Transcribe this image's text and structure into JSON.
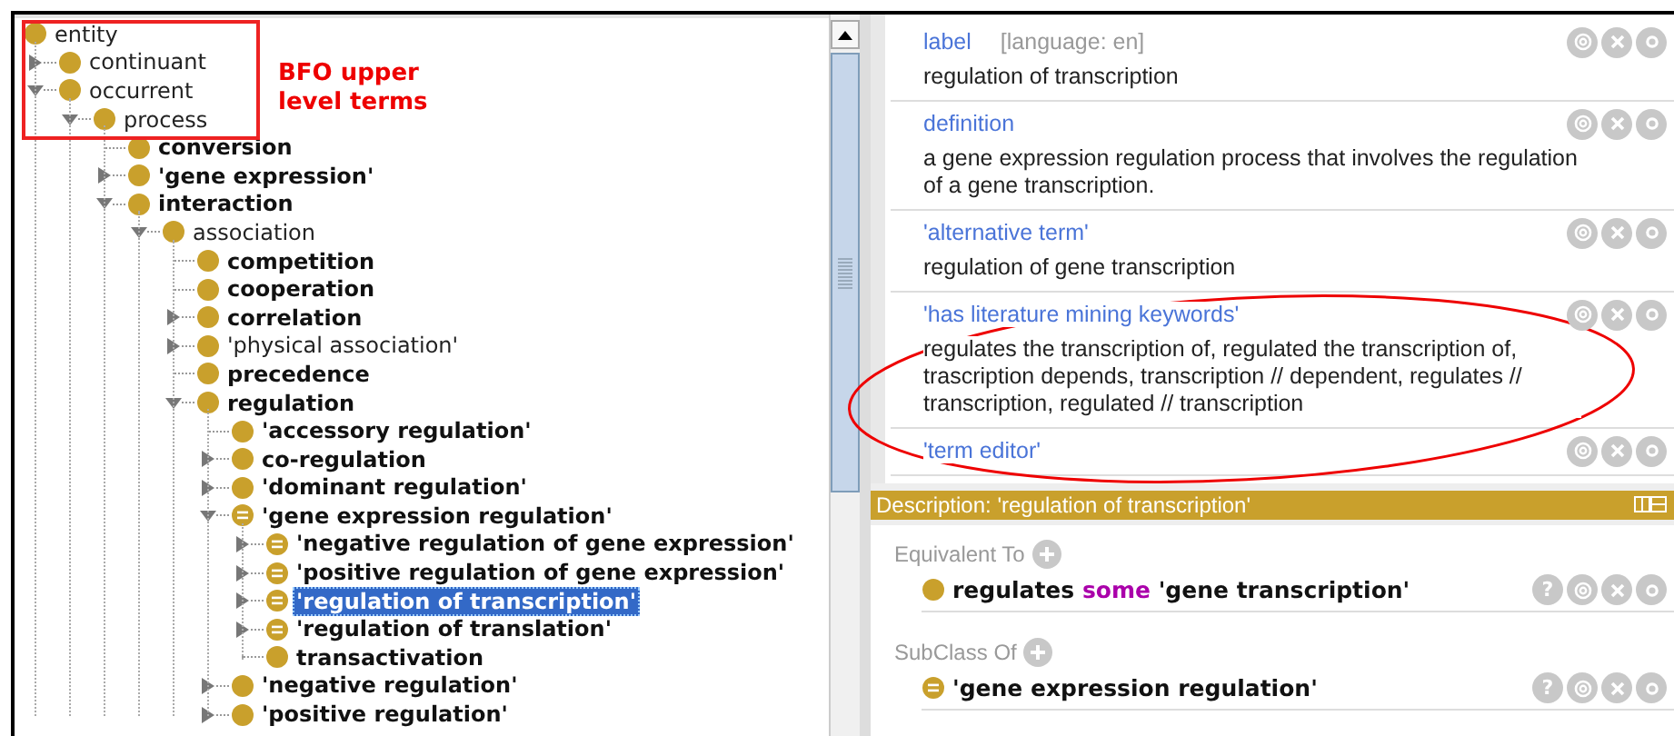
{
  "annotation_note": {
    "text": "BFO upper level terms"
  },
  "tree": [
    {
      "label": "entity",
      "bold": false,
      "defined": false,
      "selected": false,
      "children": [
        {
          "label": "continuant",
          "bold": false,
          "defined": false,
          "selected": false,
          "expanded": false
        },
        {
          "label": "occurrent",
          "bold": false,
          "defined": false,
          "selected": false,
          "expanded": true,
          "children": [
            {
              "label": "process",
              "bold": false,
              "defined": false,
              "selected": false,
              "expanded": true,
              "children": [
                {
                  "label": "conversion",
                  "bold": true,
                  "defined": false,
                  "selected": false
                },
                {
                  "label": "'gene expression'",
                  "bold": true,
                  "defined": false,
                  "selected": false,
                  "expanded": false
                },
                {
                  "label": "interaction",
                  "bold": true,
                  "defined": false,
                  "selected": false,
                  "expanded": true,
                  "children": [
                    {
                      "label": "association",
                      "bold": false,
                      "defined": false,
                      "selected": false,
                      "expanded": true,
                      "children": [
                        {
                          "label": "competition",
                          "bold": true,
                          "defined": false,
                          "selected": false
                        },
                        {
                          "label": "cooperation",
                          "bold": true,
                          "defined": false,
                          "selected": false
                        },
                        {
                          "label": "correlation",
                          "bold": true,
                          "defined": false,
                          "selected": false,
                          "expanded": false
                        },
                        {
                          "label": "'physical association'",
                          "bold": false,
                          "defined": false,
                          "selected": false,
                          "expanded": false
                        },
                        {
                          "label": "precedence",
                          "bold": true,
                          "defined": false,
                          "selected": false
                        },
                        {
                          "label": "regulation",
                          "bold": true,
                          "defined": false,
                          "selected": false,
                          "expanded": true,
                          "children": [
                            {
                              "label": "'accessory regulation'",
                              "bold": true,
                              "defined": false,
                              "selected": false
                            },
                            {
                              "label": "co-regulation",
                              "bold": true,
                              "defined": false,
                              "selected": false,
                              "expanded": false
                            },
                            {
                              "label": "'dominant regulation'",
                              "bold": true,
                              "defined": false,
                              "selected": false,
                              "expanded": false
                            },
                            {
                              "label": "'gene expression regulation'",
                              "bold": true,
                              "defined": true,
                              "selected": false,
                              "expanded": true,
                              "children": [
                                {
                                  "label": "'negative regulation of gene expression'",
                                  "bold": true,
                                  "defined": true,
                                  "selected": false,
                                  "expanded": false
                                },
                                {
                                  "label": "'positive regulation of gene expression'",
                                  "bold": true,
                                  "defined": true,
                                  "selected": false,
                                  "expanded": false
                                },
                                {
                                  "label": "'regulation of transcription'",
                                  "bold": true,
                                  "defined": true,
                                  "selected": true,
                                  "expanded": false
                                },
                                {
                                  "label": "'regulation of translation'",
                                  "bold": true,
                                  "defined": true,
                                  "selected": false,
                                  "expanded": false
                                },
                                {
                                  "label": "transactivation",
                                  "bold": true,
                                  "defined": false,
                                  "selected": false
                                }
                              ]
                            },
                            {
                              "label": "'negative regulation'",
                              "bold": true,
                              "defined": false,
                              "selected": false,
                              "expanded": false
                            },
                            {
                              "label": "'positive regulation'",
                              "bold": true,
                              "defined": false,
                              "selected": false,
                              "expanded": false
                            }
                          ]
                        }
                      ]
                    }
                  ]
                }
              ]
            }
          ]
        }
      ]
    }
  ],
  "annotations": [
    {
      "property": "label",
      "language": "[language: en]",
      "value": "regulation of transcription"
    },
    {
      "property": "definition",
      "value": "a gene expression regulation process that involves the regulation of a gene transcription."
    },
    {
      "property": "'alternative term'",
      "value": "regulation of gene transcription"
    },
    {
      "property": "'has literature mining keywords'",
      "value": "regulates the transcription of, regulated the transcription of, trascription depends, transcription // dependent, regulates // transcription, regulated // transcription"
    },
    {
      "property": "'term editor'"
    }
  ],
  "description": {
    "title": "Description: 'regulation of transcription'",
    "sections": [
      {
        "heading": "Equivalent To",
        "items": [
          {
            "defined": false,
            "explain": "?",
            "parts": [
              {
                "kind": "name",
                "text": "regulates "
              },
              {
                "kind": "keyword",
                "text": "some"
              },
              {
                "kind": "name",
                "text": " 'gene transcription'"
              }
            ]
          }
        ]
      },
      {
        "heading": "SubClass Of",
        "items": [
          {
            "defined": true,
            "explain": "?",
            "parts": [
              {
                "kind": "name",
                "text": "'gene expression regulation'"
              }
            ]
          }
        ]
      }
    ]
  }
}
